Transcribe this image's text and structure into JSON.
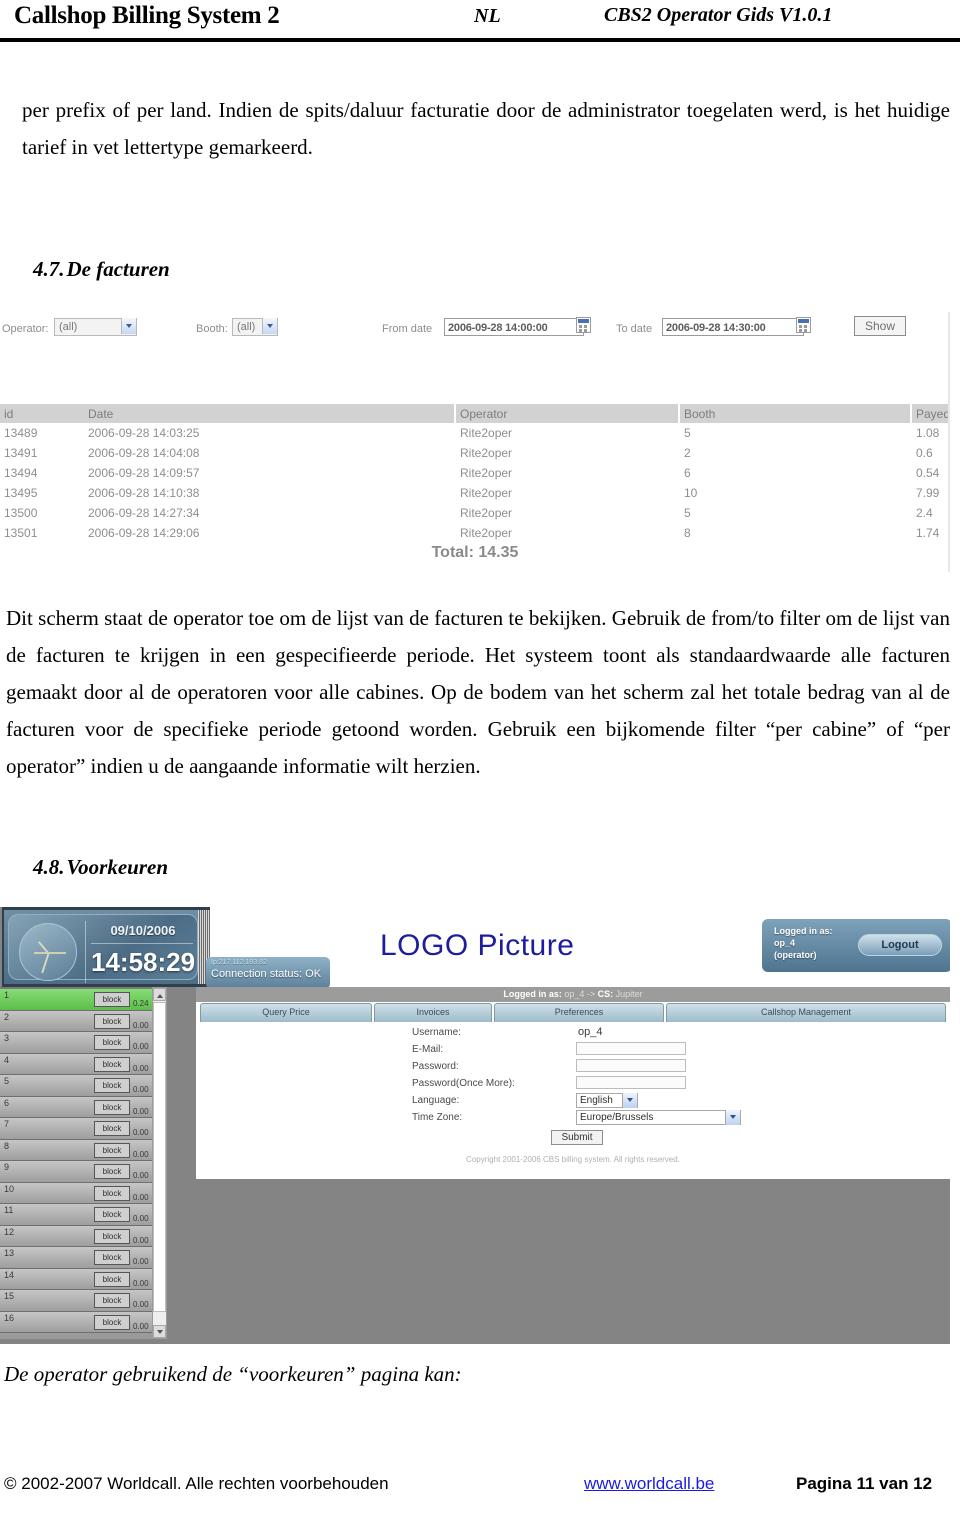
{
  "header": {
    "title": "Callshop Billing System 2",
    "language": "NL",
    "guide": "CBS2 Operator Gids V1.0.1"
  },
  "paragraphs": {
    "intro": "per prefix of per land. Indien de spits/daluur facturatie door de administrator toegelaten werd, is het huidige tarief in vet lettertype gemarkeerd.",
    "invoices_desc": "Dit scherm staat de operator toe om de lijst van de facturen te bekijken. Gebruik de from/to filter om de lijst van de facturen te krijgen in een gespecifieerde periode. Het systeem toont als standaardwaarde alle facturen gemaakt door al de operatoren voor alle cabines. Op de bodem van het scherm zal het totale bedrag van al de facturen voor de specifieke periode getoond worden. Gebruik een bijkomende filter “per cabine” of “per operator” indien u de aangaande informatie wilt herzien.",
    "prefs_caption": "De operator gebruikend de “voorkeuren” pagina kan:"
  },
  "sections": {
    "invoices": {
      "number": "4.7.",
      "title": "De facturen"
    },
    "preferences": {
      "number": "4.8.",
      "title": "Voorkeuren"
    }
  },
  "invoices_screen": {
    "filters": {
      "operator_label": "Operator:",
      "operator_value": "(all)",
      "booth_label": "Booth:",
      "booth_value": "(all)",
      "from_label": "From date",
      "from_value": "2006-09-28 14:00:00",
      "to_label": "To date",
      "to_value": "2006-09-28 14:30:00",
      "show_button": "Show"
    },
    "columns": [
      "id",
      "Date",
      "Operator",
      "Booth",
      "Payed"
    ],
    "rows": [
      {
        "id": "13489",
        "date": "2006-09-28 14:03:25",
        "operator": "Rite2oper",
        "booth": "5",
        "payed": "1.08"
      },
      {
        "id": "13491",
        "date": "2006-09-28 14:04:08",
        "operator": "Rite2oper",
        "booth": "2",
        "payed": "0.6"
      },
      {
        "id": "13494",
        "date": "2006-09-28 14:09:57",
        "operator": "Rite2oper",
        "booth": "6",
        "payed": "0.54"
      },
      {
        "id": "13495",
        "date": "2006-09-28 14:10:38",
        "operator": "Rite2oper",
        "booth": "10",
        "payed": "7.99"
      },
      {
        "id": "13500",
        "date": "2006-09-28 14:27:34",
        "operator": "Rite2oper",
        "booth": "5",
        "payed": "2.4"
      },
      {
        "id": "13501",
        "date": "2006-09-28 14:29:06",
        "operator": "Rite2oper",
        "booth": "8",
        "payed": "1.74"
      }
    ],
    "total": "Total: 14.35"
  },
  "preferences_screen": {
    "clock": {
      "date": "09/10/2006",
      "time": "14:58:29"
    },
    "connection": {
      "ip": "Ip:217.112.183.82",
      "status": "Connection status: OK"
    },
    "logo": "LOGO Picture",
    "session": {
      "logged_in_label": "Logged in as:",
      "user": "op_4",
      "role": "(operator)",
      "logout_button": "Logout"
    },
    "statusbar": {
      "prefix": "Logged in as:",
      "user": "op_4 -> ",
      "cs_label": "CS:",
      "cs_value": "Jupiter"
    },
    "tabs": [
      {
        "label": "Query Price"
      },
      {
        "label": "Invoices"
      },
      {
        "label": "Preferences"
      },
      {
        "label": "Callshop Management"
      }
    ],
    "form": {
      "username_label": "Username:",
      "username_value": "op_4",
      "email_label": "E-Mail:",
      "email_value": "",
      "password_label": "Password:",
      "password_value": "",
      "password2_label": "Password(Once More):",
      "password2_value": "",
      "language_label": "Language:",
      "language_value": "English",
      "timezone_label": "Time Zone:",
      "timezone_value": "Europe/Brussels",
      "submit_button": "Submit"
    },
    "copyright": "Copyright 2001-2006 CBS billing system. All rights reserved.",
    "booths": [
      {
        "num": "1",
        "block": "block",
        "amount": "0.24",
        "active": true
      },
      {
        "num": "2",
        "block": "block",
        "amount": "0.00",
        "active": false
      },
      {
        "num": "3",
        "block": "block",
        "amount": "0.00",
        "active": false
      },
      {
        "num": "4",
        "block": "block",
        "amount": "0.00",
        "active": false
      },
      {
        "num": "5",
        "block": "block",
        "amount": "0.00",
        "active": false
      },
      {
        "num": "6",
        "block": "block",
        "amount": "0.00",
        "active": false
      },
      {
        "num": "7",
        "block": "block",
        "amount": "0.00",
        "active": false
      },
      {
        "num": "8",
        "block": "block",
        "amount": "0.00",
        "active": false
      },
      {
        "num": "9",
        "block": "block",
        "amount": "0.00",
        "active": false
      },
      {
        "num": "10",
        "block": "block",
        "amount": "0.00",
        "active": false
      },
      {
        "num": "11",
        "block": "block",
        "amount": "0.00",
        "active": false
      },
      {
        "num": "12",
        "block": "block",
        "amount": "0.00",
        "active": false
      },
      {
        "num": "13",
        "block": "block",
        "amount": "0.00",
        "active": false
      },
      {
        "num": "14",
        "block": "block",
        "amount": "0.00",
        "active": false
      },
      {
        "num": "15",
        "block": "block",
        "amount": "0.00",
        "active": false
      },
      {
        "num": "16",
        "block": "block",
        "amount": "0.00",
        "active": false
      }
    ]
  },
  "footer": {
    "copyright": "© 2002-2007 Worldcall. Alle rechten voorbehouden",
    "link": "www.worldcall.be",
    "page": "Pagina 11 van 12"
  },
  "colors": {
    "link": "#1a1ae0",
    "logo": "#1d1d9e",
    "active_booth": "#5dbe49",
    "panel_blue": "#5d819b"
  }
}
